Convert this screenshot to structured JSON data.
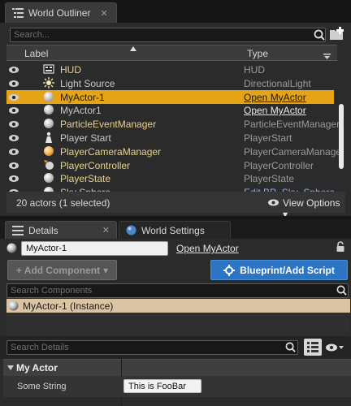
{
  "outliner": {
    "tab_title": "World Outliner",
    "close_glyph": "✕",
    "search_placeholder": "Search...",
    "columns": {
      "label": "Label",
      "type": "Type"
    },
    "rows": [
      {
        "label": "HUD",
        "type": "HUD",
        "icon": "hud-icon",
        "selected": false
      },
      {
        "label": "Light Source",
        "type": "DirectionalLight",
        "icon": "light-icon",
        "selected": false
      },
      {
        "label": "MyActor-1",
        "type": "Open MyActor",
        "icon": "sphere-icon",
        "selected": true
      },
      {
        "label": "MyActor1",
        "type": "Open MyActor",
        "icon": "sphere-icon",
        "selected": false
      },
      {
        "label": "ParticleEventManager",
        "type": "ParticleEventManager",
        "icon": "sphere-icon",
        "selected": false
      },
      {
        "label": "Player Start",
        "type": "PlayerStart",
        "icon": "player-start-icon",
        "selected": false
      },
      {
        "label": "PlayerCameraManager",
        "type": "PlayerCameraManage",
        "icon": "sphere-orange-icon",
        "selected": false
      },
      {
        "label": "PlayerController",
        "type": "PlayerController",
        "icon": "controller-icon",
        "selected": false
      },
      {
        "label": "PlayerState",
        "type": "PlayerState",
        "icon": "sphere-icon",
        "selected": false
      },
      {
        "label": "Sky Sphere",
        "type": "Edit BP_Sky_Sphere",
        "icon": "sphere-icon",
        "selected": false
      }
    ],
    "status": "20 actors (1 selected)",
    "view_options": "View Options",
    "view_options_arrow": "▾"
  },
  "details": {
    "tab_title": "Details",
    "close_glyph": "✕",
    "world_settings_tab": "World Settings",
    "actor_name": "MyActor-1",
    "open_link": "Open MyActor",
    "add_component": "+ Add Component",
    "add_component_arrow": "▾",
    "blueprint_button": "Blueprint/Add Script",
    "search_components_placeholder": "Search Components",
    "instance_label": "MyActor-1 (Instance)",
    "search_details_placeholder": "Search Details",
    "category": "My Actor",
    "property_name": "Some String",
    "property_value": "This is FooBar"
  },
  "colors": {
    "selection": "#e4a416",
    "blueprint_button": "#2c74c4",
    "instance_row": "#d9c4a4",
    "link_blue": "#7fb2ff"
  }
}
